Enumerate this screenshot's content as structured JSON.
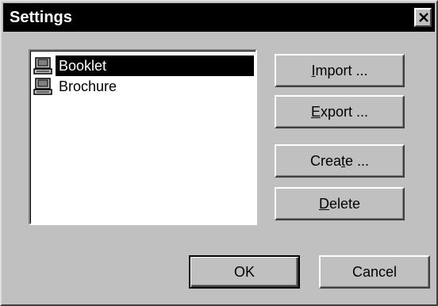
{
  "window": {
    "title": "Settings"
  },
  "list": {
    "items": [
      {
        "label": "Booklet",
        "selected": true,
        "icon": "computer-icon"
      },
      {
        "label": "Brochure",
        "selected": false,
        "icon": "computer-icon"
      }
    ]
  },
  "buttons": {
    "import": {
      "prefix": "",
      "accel": "I",
      "suffix": "mport ..."
    },
    "export": {
      "prefix": "",
      "accel": "E",
      "suffix": "xport ..."
    },
    "create": {
      "prefix": "Crea",
      "accel": "t",
      "suffix": "e ..."
    },
    "delete": {
      "prefix": "",
      "accel": "D",
      "suffix": "elete"
    },
    "ok": {
      "label": "OK"
    },
    "cancel": {
      "label": "Cancel"
    }
  },
  "colors": {
    "face": "#c0c0c0",
    "titlebar": "#000000",
    "selection": "#000000"
  }
}
